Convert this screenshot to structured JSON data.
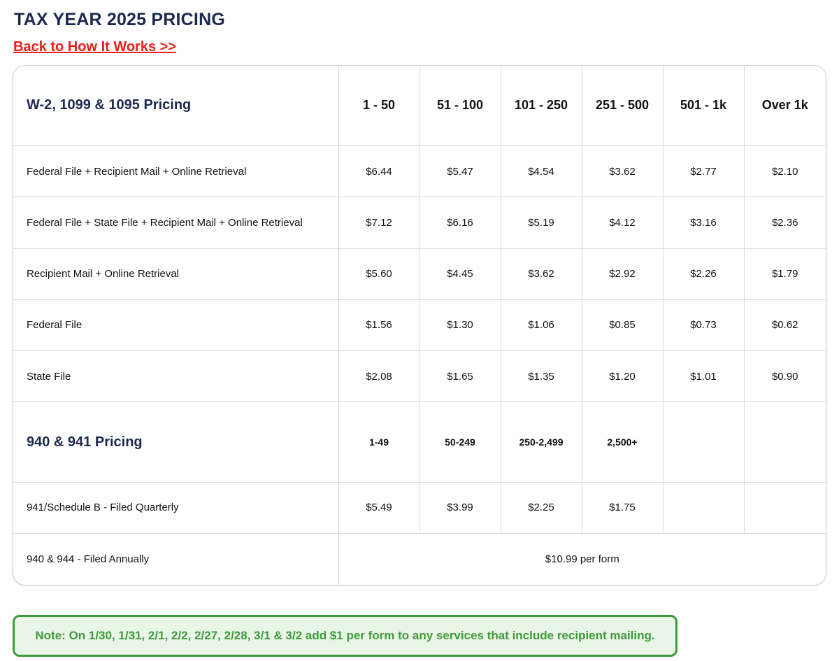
{
  "page_title": "TAX YEAR 2025 PRICING",
  "back_link": "Back to How It Works >>",
  "w2_section": {
    "title": "W-2, 1099 & 1095 Pricing",
    "tiers": [
      "1 - 50",
      "51 - 100",
      "101 - 250",
      "251 - 500",
      "501 - 1k",
      "Over 1k"
    ],
    "rows": [
      {
        "label": "Federal File + Recipient Mail + Online Retrieval",
        "prices": [
          "$6.44",
          "$5.47",
          "$4.54",
          "$3.62",
          "$2.77",
          "$2.10"
        ]
      },
      {
        "label": "Federal File + State File + Recipient Mail + Online Retrieval",
        "prices": [
          "$7.12",
          "$6.16",
          "$5.19",
          "$4.12",
          "$3.16",
          "$2.36"
        ]
      },
      {
        "label": "Recipient Mail + Online Retrieval",
        "prices": [
          "$5.60",
          "$4.45",
          "$3.62",
          "$2.92",
          "$2.26",
          "$1.79"
        ]
      },
      {
        "label": "Federal File",
        "prices": [
          "$1.56",
          "$1.30",
          "$1.06",
          "$0.85",
          "$0.73",
          "$0.62"
        ]
      },
      {
        "label": "State File",
        "prices": [
          "$2.08",
          "$1.65",
          "$1.35",
          "$1.20",
          "$1.01",
          "$0.90"
        ]
      }
    ]
  },
  "f940_section": {
    "title": "940 & 941 Pricing",
    "tiers": [
      "1-49",
      "50-249",
      "250-2,499",
      "2,500+"
    ],
    "rows": [
      {
        "label": "941/Schedule B - Filed Quarterly",
        "prices": [
          "$5.49",
          "$3.99",
          "$2.25",
          "$1.75"
        ]
      }
    ],
    "annual_row": {
      "label": "940 & 944 - Filed Annually",
      "price": "$10.99 per form"
    }
  },
  "note": "Note: On 1/30, 1/31, 2/1, 2/2, 2/27, 2/28, 3/1 & 3/2 add $1 per form to any services that include recipient mailing.",
  "colors": {
    "heading": "#1b2a4e",
    "link": "#e8201b",
    "note_text": "#3f9a3c",
    "note_bg": "#e9f5e7"
  }
}
